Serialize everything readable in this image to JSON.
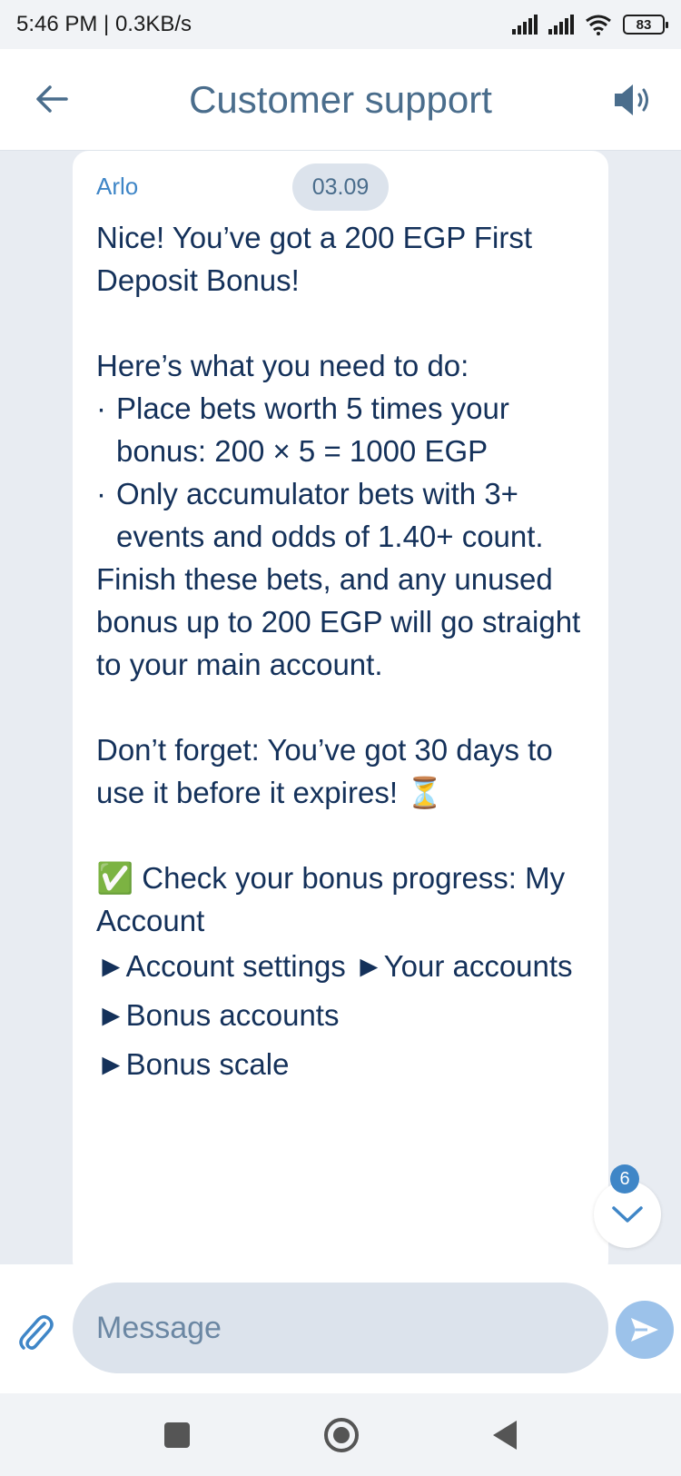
{
  "status_bar": {
    "time_speed": "5:46 PM | 0.3KB/s",
    "battery": "83"
  },
  "header": {
    "title": "Customer support"
  },
  "chat": {
    "sender": "Arlo",
    "date": "03.09",
    "message": {
      "line1": "Nice! You’ve got a 200 EGP First Deposit Bonus!",
      "line2": "Here’s what you need to do:",
      "bullet_mark": "·",
      "bullet1": "Place bets worth 5 times your bonus: 200 × 5 = 1000 EGP",
      "bullet2": "Only accumulator bets with 3+ events and odds of 1.40+ count.",
      "line3": "Finish these bets, and any unused bonus up to 200 EGP will go straight to your main account.",
      "line4": "Don’t forget: You’ve got 30 days to use it before it expires! ⏳",
      "line5": "✅ Check your bonus progress: My Account",
      "guide1": "►Account settings ►Your accounts ►Bonus accounts",
      "guide2": "►Bonus scale"
    },
    "unread_count": "6"
  },
  "composer": {
    "placeholder": "Message"
  },
  "colors": {
    "accent": "#3f86c7",
    "title": "#4a6d8c",
    "send": "#9cc2ea"
  }
}
